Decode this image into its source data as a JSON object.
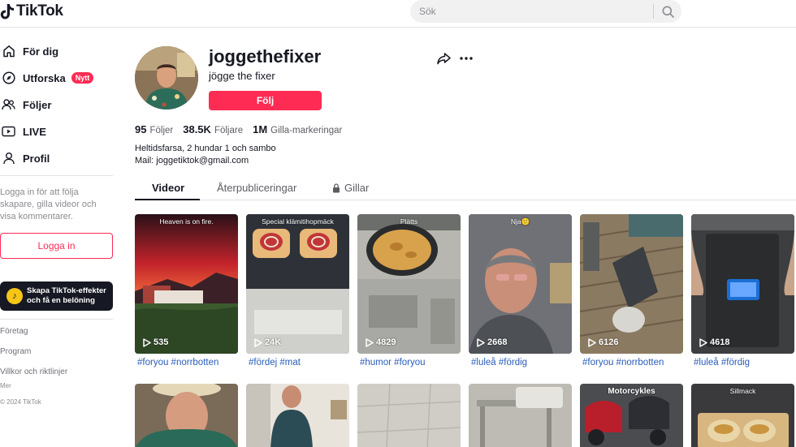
{
  "brand": {
    "name": "TikTok"
  },
  "search": {
    "placeholder": "Sök"
  },
  "sidebar": {
    "nav": [
      {
        "label": "För dig"
      },
      {
        "label": "Utforska",
        "badge": "Nytt"
      },
      {
        "label": "Följer"
      },
      {
        "label": "LIVE"
      },
      {
        "label": "Profil"
      }
    ],
    "login_prompt": "Logga in för att följa skapare, gilla videor och visa kommentarer.",
    "login_button": "Logga in",
    "promo": "Skapa TikTok-effekter och få en belöning",
    "footer": {
      "company": "Företag",
      "program": "Program",
      "terms": "Villkor och riktlinjer",
      "more": "Mer",
      "copyright": "© 2024 TikTok"
    }
  },
  "profile": {
    "username": "joggethefixer",
    "display_name": "jögge the fixer",
    "follow_label": "Följ",
    "stats": [
      {
        "value": "95",
        "label": "Följer"
      },
      {
        "value": "38.5K",
        "label": "Följare"
      },
      {
        "value": "1M",
        "label": "Gilla-markeringar"
      }
    ],
    "bio_line1": "Heltidsfarsa, 2 hundar 1 och sambo",
    "bio_line2": "Mail: joggetiktok@gmail.com"
  },
  "tabs": [
    {
      "label": "Videor"
    },
    {
      "label": "Återpubliceringar"
    },
    {
      "label": "Gillar"
    }
  ],
  "videos": [
    {
      "caption": "Heaven is on fire.",
      "views": "535",
      "tags": "#foryou #norrbotten"
    },
    {
      "caption": "Special klämitihopmäck",
      "views": "24K",
      "tags": "#fördej #mat"
    },
    {
      "caption": "Plätts",
      "views": "4829",
      "tags": "#humor #foryou"
    },
    {
      "caption": "Nja🙂",
      "views": "2668",
      "tags": "#luleå #fördig"
    },
    {
      "caption": "",
      "views": "6126",
      "tags": "#foryou #norrbotten"
    },
    {
      "caption": "",
      "views": "4618",
      "tags": "#luleå #fördig"
    }
  ],
  "videos_row2": [
    {
      "caption": ""
    },
    {
      "caption": ""
    },
    {
      "caption": ""
    },
    {
      "caption": ""
    },
    {
      "caption": "Motorcykles"
    },
    {
      "caption": "Sillmack"
    }
  ],
  "colors": {
    "accent": "#fe2c55",
    "tag": "#2b5db9"
  }
}
